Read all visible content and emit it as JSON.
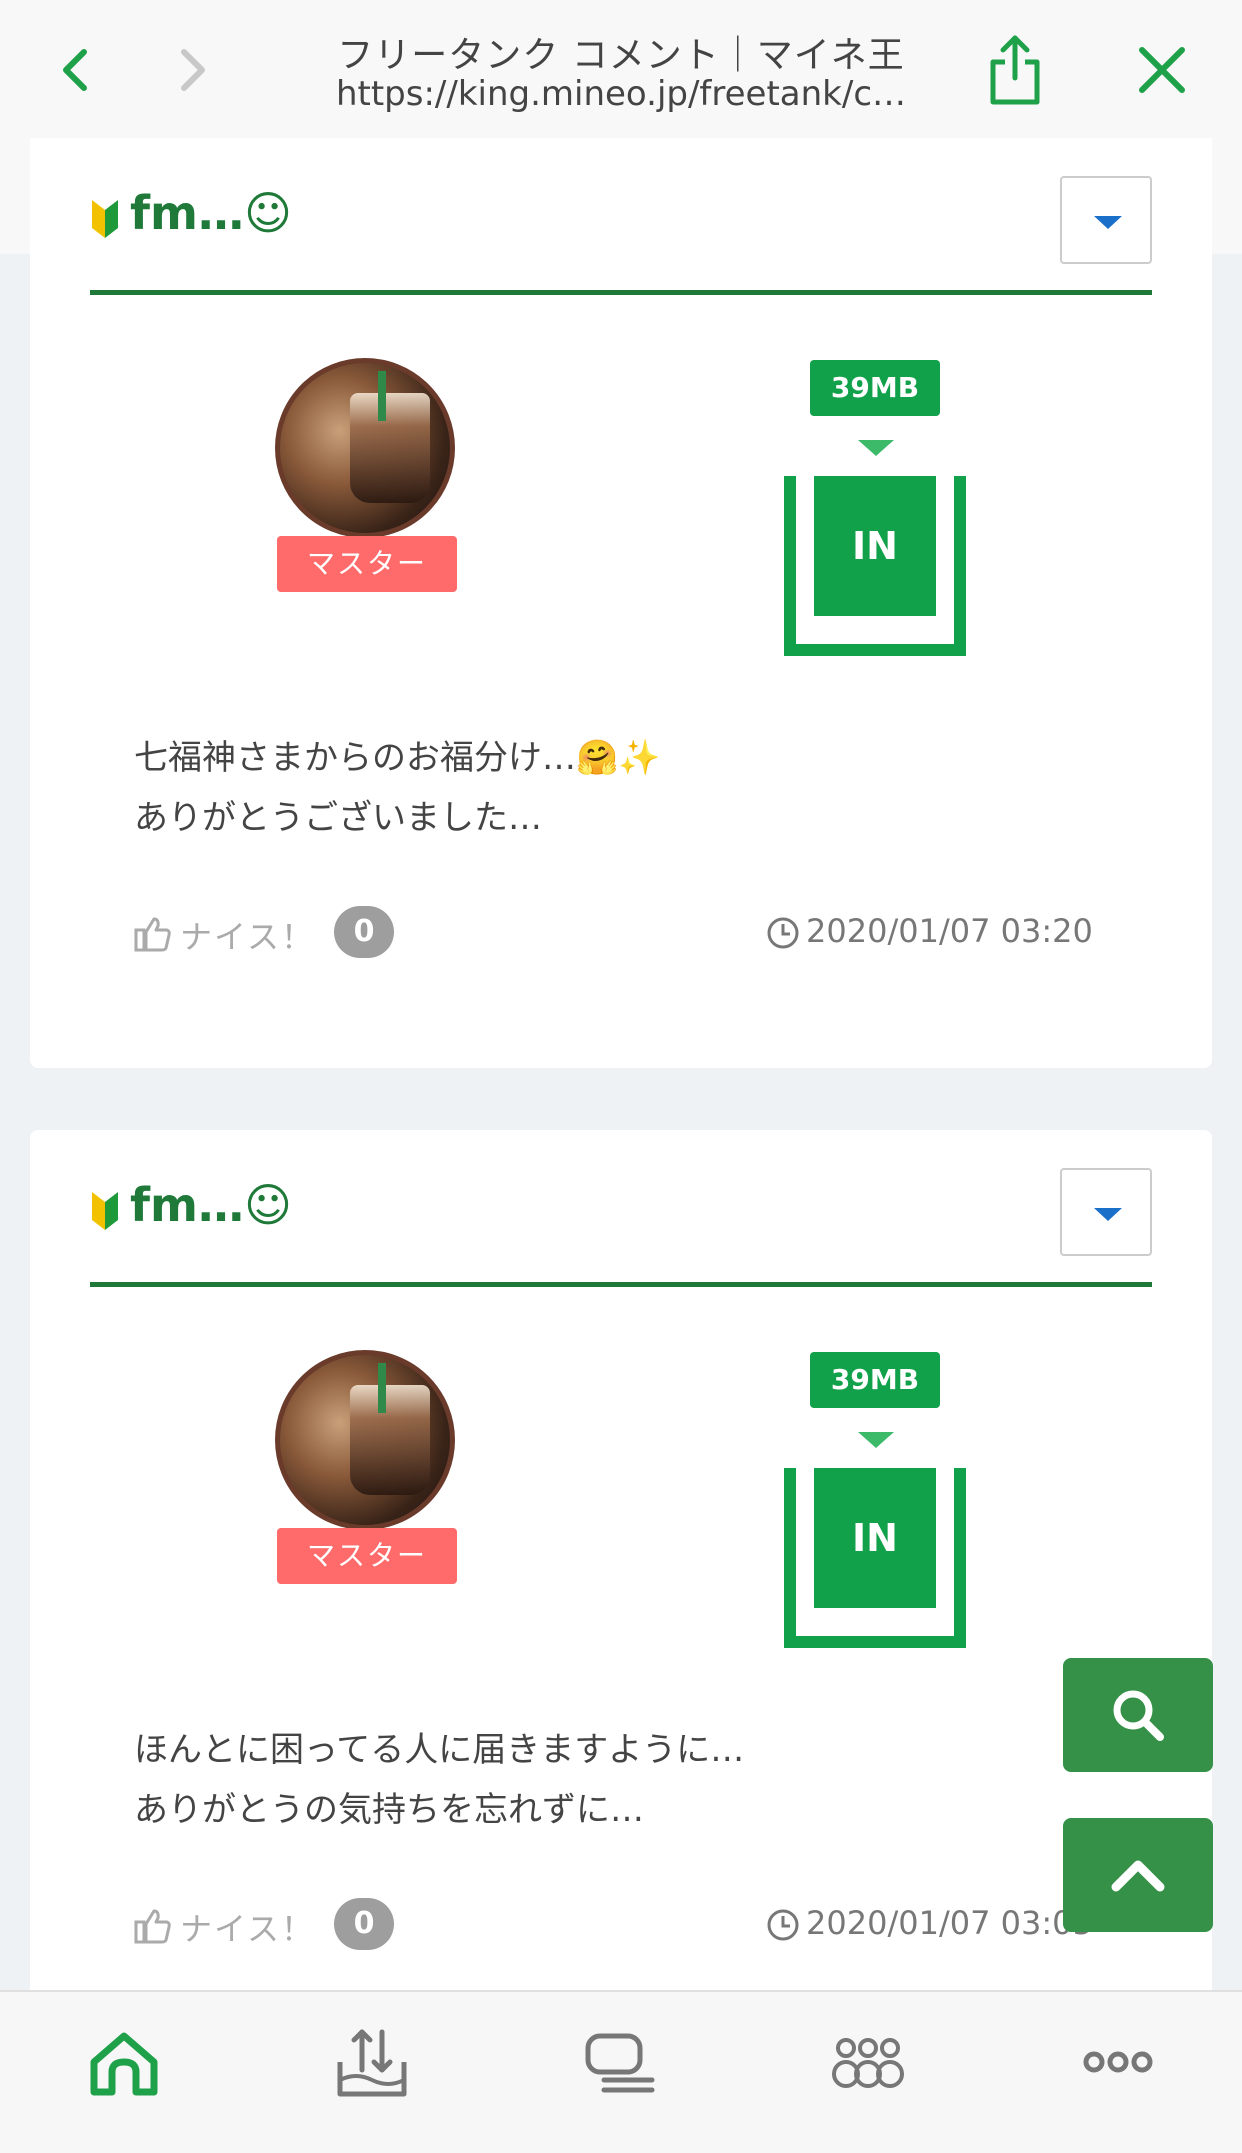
{
  "browser": {
    "title": "フリータンク コメント｜マイネ王",
    "url": "https://king.mineo.jp/freetank/c…"
  },
  "icons": {
    "back": "chevron-left-icon",
    "forward": "chevron-right-icon",
    "share": "share-icon",
    "close": "close-icon",
    "search": "search-icon",
    "scroll_top": "chevron-up-icon"
  },
  "colors": {
    "accent_green": "#1f7a3a",
    "tank_green": "#11a14a",
    "badge_red": "#ff6b6b",
    "dropdown_blue": "#1a6fc9"
  },
  "comments": [
    {
      "username": "fm…☺",
      "badge": "マスター",
      "amount": "39MB",
      "direction": "IN",
      "text_line1": "七福神さまからのお福分け…🤗✨",
      "text_line2": "ありがとうございました…",
      "nice_label": "ナイス！",
      "nice_count": "0",
      "timestamp": "2020/01/07 03:20"
    },
    {
      "username": "fm…☺",
      "badge": "マスター",
      "amount": "39MB",
      "direction": "IN",
      "text_line1": "ほんとに困ってる人に届きますように…",
      "text_line2": "ありがとうの気持ちを忘れずに…",
      "nice_label": "ナイス！",
      "nice_count": "0",
      "timestamp": "2020/01/07 03:05"
    }
  ],
  "tabbar": {
    "items": [
      "home-icon",
      "tank-icon",
      "chat-icon",
      "community-icon",
      "more-icon"
    ],
    "active": 0
  }
}
